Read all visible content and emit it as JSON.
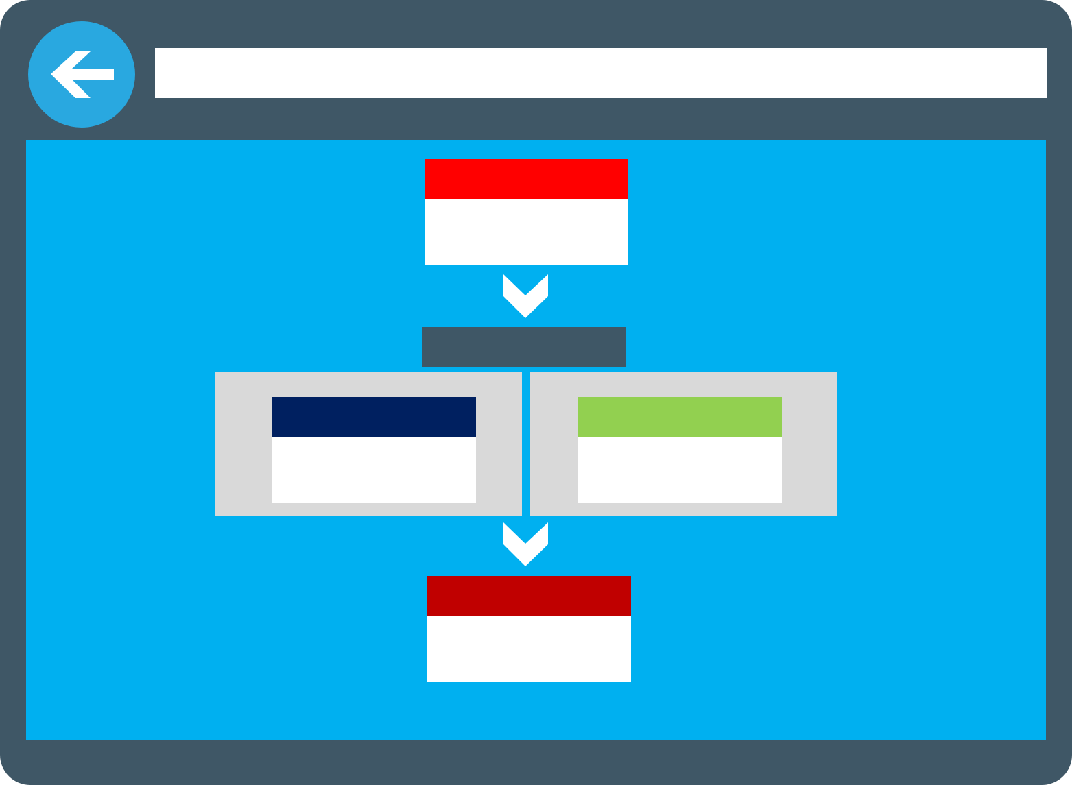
{
  "browser": {
    "address_value": "",
    "back_icon": "arrow-left-icon"
  },
  "colors": {
    "frame": "#3f5766",
    "viewport": "#00b0f0",
    "back_button": "#29a8e0",
    "start_header": "#ff0000",
    "branch_bar": "#3f5766",
    "panel": "#d9d9d9",
    "left_header": "#002060",
    "right_header": "#92d050",
    "end_header": "#c00000",
    "arrow": "#ffffff"
  },
  "diagram": {
    "arrow_icon": "chevron-down-icon",
    "nodes": [
      "start-step",
      "branch-left",
      "branch-right",
      "end-step"
    ]
  }
}
